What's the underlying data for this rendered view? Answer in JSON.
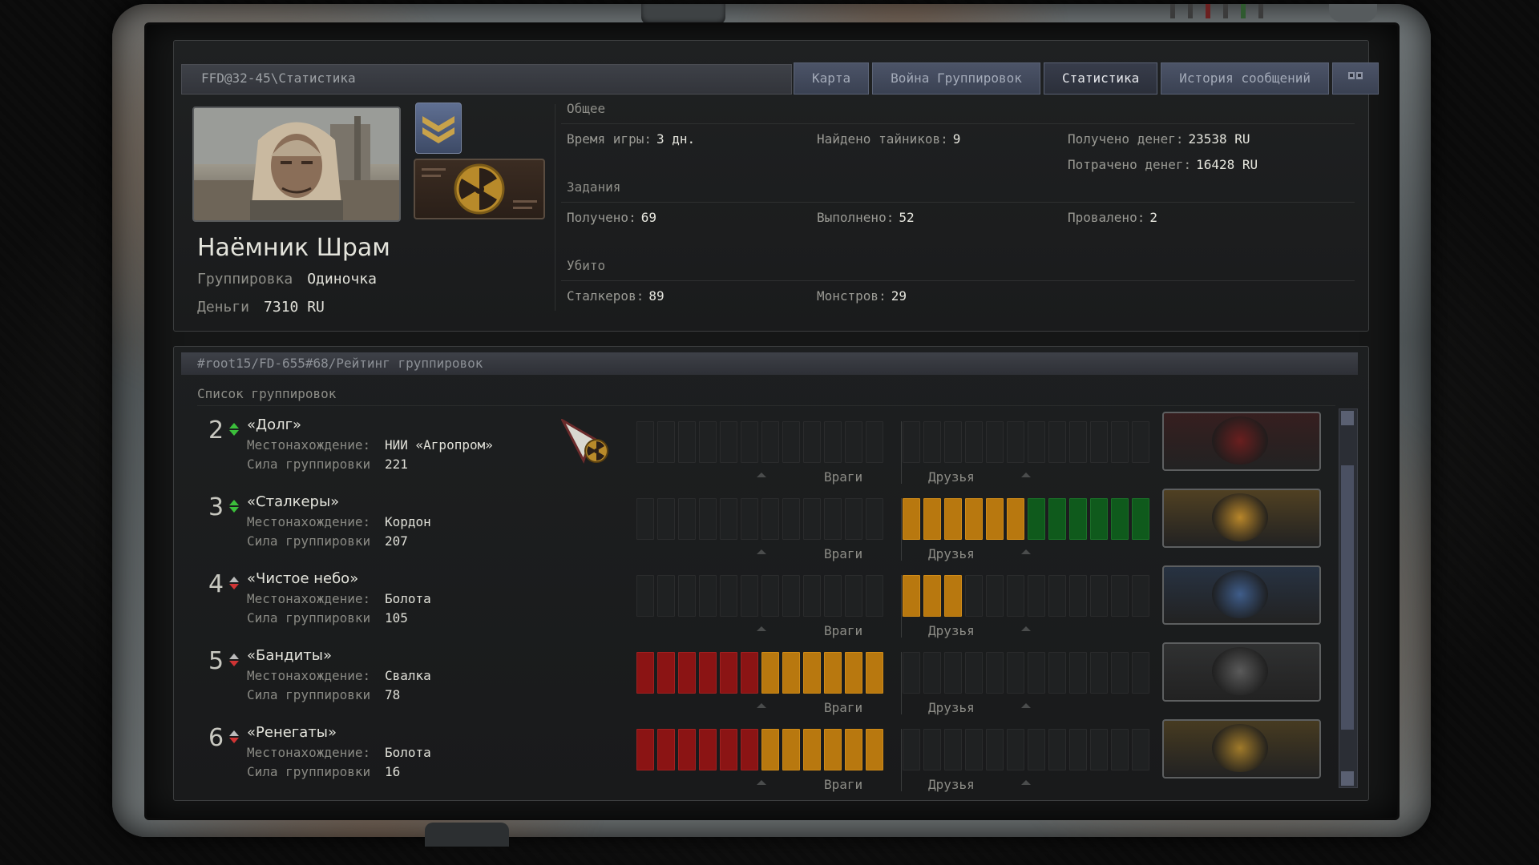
{
  "window": {
    "path": "FFD@32-45\\Статистика"
  },
  "tabs": [
    {
      "label": "Карта",
      "active": false
    },
    {
      "label": "Война Группировок",
      "active": false
    },
    {
      "label": "Статистика",
      "active": true
    },
    {
      "label": "История сообщений",
      "active": false
    }
  ],
  "player": {
    "name": "Наёмник Шрам",
    "faction_label": "Группировка",
    "faction_value": "Одиночка",
    "money_label": "Деньги",
    "money_value": "7310 RU"
  },
  "stats": {
    "general": {
      "heading": "Общее",
      "play_time_label": "Время игры:",
      "play_time_value": "3 дн.",
      "stashes_label": "Найдено тайников:",
      "stashes_value": "9",
      "money_got_label": "Получено денег:",
      "money_got_value": "23538 RU",
      "money_spent_label": "Потрачено денег:",
      "money_spent_value": "16428 RU"
    },
    "tasks": {
      "heading": "Задания",
      "received_label": "Получено:",
      "received_value": "69",
      "done_label": "Выполнено:",
      "done_value": "52",
      "failed_label": "Провалено:",
      "failed_value": "2"
    },
    "killed": {
      "heading": "Убито",
      "stalkers_label": "Сталкеров:",
      "stalkers_value": "89",
      "monsters_label": "Монстров:",
      "monsters_value": "29"
    }
  },
  "rating": {
    "path": "#root15/FD-655#68/Рейтинг группировок",
    "list_heading": "Список группировок",
    "location_label": "Местонахождение:",
    "strength_label": "Сила группировки",
    "enemies_label": "Враги",
    "friends_label": "Друзья",
    "factions": [
      {
        "rank": "2",
        "trend": "up",
        "name": "«Долг»",
        "location": "НИИ «Агропром»",
        "strength": "221",
        "enemies": [],
        "friends": [],
        "emblem": "dolg-emblem",
        "emblem_color": "#6a1f1f"
      },
      {
        "rank": "3",
        "trend": "up",
        "name": "«Сталкеры»",
        "location": "Кордон",
        "strength": "207",
        "enemies": [],
        "friends": [
          "o",
          "o",
          "o",
          "o",
          "o",
          "o",
          "g",
          "g",
          "g",
          "g",
          "g",
          "g"
        ],
        "emblem": "stalkers-emblem",
        "emblem_color": "#b8862a"
      },
      {
        "rank": "4",
        "trend": "down",
        "name": "«Чистое небо»",
        "location": "Болота",
        "strength": "105",
        "enemies": [],
        "friends": [
          "o",
          "o",
          "o"
        ],
        "emblem": "clear-sky-emblem",
        "emblem_color": "#3f5d8a"
      },
      {
        "rank": "5",
        "trend": "down",
        "name": "«Бандиты»",
        "location": "Свалка",
        "strength": "78",
        "enemies": [
          "r",
          "r",
          "r",
          "r",
          "r",
          "r",
          "o",
          "o",
          "o",
          "o",
          "o",
          "o"
        ],
        "friends": [],
        "emblem": "bandits-emblem",
        "emblem_color": "#5a5a5a"
      },
      {
        "rank": "6",
        "trend": "down",
        "name": "«Ренегаты»",
        "location": "Болота",
        "strength": "16",
        "enemies": [
          "r",
          "r",
          "r",
          "r",
          "r",
          "r",
          "o",
          "o",
          "o",
          "o",
          "o",
          "o"
        ],
        "friends": [],
        "emblem": "renegades-emblem",
        "emblem_color": "#a07a2a"
      }
    ]
  },
  "colors": {
    "accent_tab": "#4c5468",
    "enemy": "#8b1414",
    "neutral": "#b8780f",
    "friend": "#0f5a1c"
  }
}
